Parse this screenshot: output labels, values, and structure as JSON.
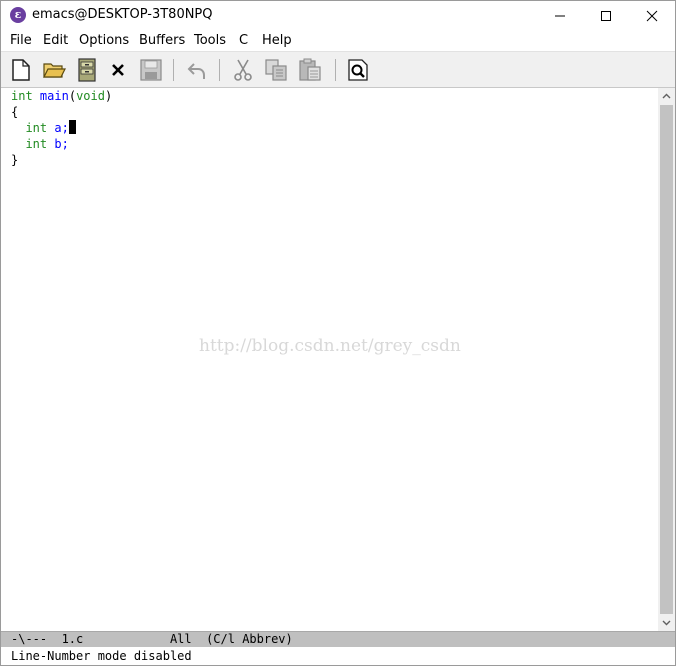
{
  "window": {
    "title": "emacs@DESKTOP-3T80NPQ",
    "icon_glyph": "ε",
    "controls": [
      "minimize-icon",
      "maximize-icon",
      "close-icon"
    ]
  },
  "menu": {
    "items": [
      "File",
      "Edit",
      "Options",
      "Buffers",
      "Tools",
      "C",
      "Help"
    ]
  },
  "toolbar": {
    "buttons": [
      "new-file-icon",
      "open-folder-icon",
      "open-directory-icon",
      "kill-buffer-icon",
      "save-icon",
      "undo-icon",
      "cut-icon",
      "copy-icon",
      "paste-icon",
      "search-icon"
    ]
  },
  "editor": {
    "lines": [
      {
        "kw": "int",
        "rest1": " ",
        "fn": "main",
        "rest2": "(",
        "kw2": "void",
        "rest3": ")"
      },
      {
        "text": "{"
      },
      {
        "indent": "  ",
        "kw": "int",
        "rest": " a;"
      },
      {
        "indent": "  ",
        "kw": "int",
        "rest": " b;"
      },
      {
        "text": "}"
      }
    ],
    "watermark": "http://blog.csdn.net/grey_csdn"
  },
  "modeline": {
    "text": "-\\---  1.c            All  (C/l Abbrev)"
  },
  "echo_area": {
    "text": "Line-Number mode disabled"
  },
  "colors": {
    "keyword": "#228b22",
    "function_name": "#0000ff",
    "modeline_bg": "#bfbfbf"
  }
}
